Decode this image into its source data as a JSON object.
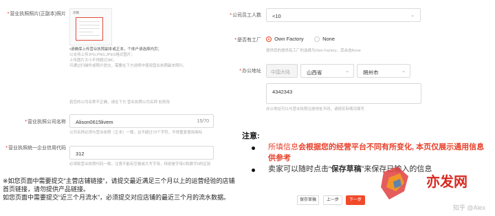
{
  "left": {
    "license_label": "营业执照照片(正副本)照片",
    "preview_caption": "示例",
    "upload_tips": [
      "•请确保上传营业执照副本或正本，个体户请选择内页；",
      "以支持上传JPG,PNG,JPEG格式图片；",
      "上传图片大小不得超过3M；",
      "可通过扫描件或照片提交，需要在下方说明中使用营业执照副本照片。"
    ],
    "license_hint": "若您的公司名称不正确，请在下方 营业执照公司名称 处修改",
    "company_name_label": "营业执照公司名称",
    "company_name_value": "Alison0615livem",
    "company_name_counter": "15/70",
    "company_name_hint": "公司名称必须与营业执照（正本）一致，且不超过70个字符，不得重复使用商标",
    "credit_code_label": "营业执照统一企业信用代码",
    "credit_code_value": "312",
    "credit_code_hint": "必须和营业执照代码一致，注意不能有空格或大写字母，特别是字母O和数字0的区别"
  },
  "right": {
    "company_size_label": "公司员工人数",
    "company_size_value": "<10",
    "factory_label": "是否有工厂",
    "factory_option_yes": "Own Factory",
    "factory_option_no": "None",
    "factory_hint": "提供您的提供有工厂的选择为Own Factory，其余选None",
    "address_label": "办公地址",
    "country_value": "中国大陆",
    "province_value": "山西省",
    "city_value": "朔州市",
    "address_value": "4342343",
    "address_hint": "办公地址可以与营业执照注册地址不同，请按实际情况填写"
  },
  "note": {
    "title": "注意:",
    "line1_red": "所填信息",
    "line1_rest": "会根据您的经营平台不同有所变化, 本页仅展示通用信息供参考",
    "line2_a": "卖家可以随时点击“",
    "line2_b": "保存草稿",
    "line2_c": "”来保存已输入的信息"
  },
  "buttons": {
    "save_draft": "保存草稿",
    "prev": "上一步",
    "next": "下一步"
  },
  "bottom_note": "※如您页面中需要提交“主营店铺链接”，请提交最近满足三个月以上的运营经验的店铺首页链接，请勿提供产品链接。\n如您页面中需要提交“近三个月流水”，必须提交对应店铺的最近三个月的流水数据。",
  "watermark": "知乎 @Alex",
  "logo_text": "亦发网",
  "colors": {
    "accent": "#f04a2a",
    "required": "#e02020",
    "note_red": "#e8402a"
  }
}
